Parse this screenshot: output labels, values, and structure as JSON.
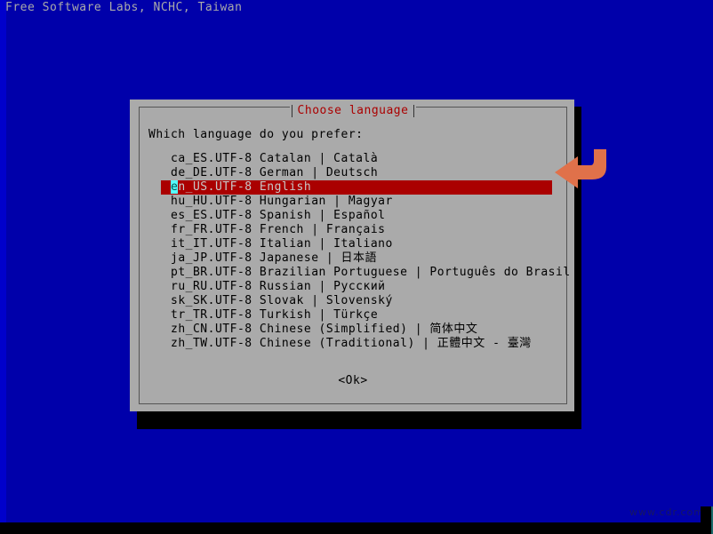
{
  "screen": {
    "header_text": "Free Software Labs, NCHC, Taiwan",
    "background_color": "#0000aa",
    "watermark": "www.cdr.com"
  },
  "dialog": {
    "title": "Choose language",
    "title_color": "#aa0000",
    "prompt": "Which language do you prefer:",
    "background_color": "#aaaaaa",
    "ok_label": "<Ok>",
    "selected_index": 2,
    "highlight_color": "#aa0000",
    "cursor_color": "#55ffff",
    "languages": [
      {
        "locale": "ca_ES.UTF-8",
        "english": "Catalan",
        "native": "| Català"
      },
      {
        "locale": "de_DE.UTF-8",
        "english": "German",
        "native": "| Deutsch"
      },
      {
        "locale": "en_US.UTF-8",
        "english": "English",
        "native": ""
      },
      {
        "locale": "hu_HU.UTF-8",
        "english": "Hungarian",
        "native": "| Magyar"
      },
      {
        "locale": "es_ES.UTF-8",
        "english": "Spanish",
        "native": "| Español"
      },
      {
        "locale": "fr_FR.UTF-8",
        "english": "French",
        "native": "| Français"
      },
      {
        "locale": "it_IT.UTF-8",
        "english": "Italian",
        "native": "| Italiano"
      },
      {
        "locale": "ja_JP.UTF-8",
        "english": "Japanese",
        "native": "| 日本語"
      },
      {
        "locale": "pt_BR.UTF-8",
        "english": "Brazilian Portuguese",
        "native": "| Português do Brasil"
      },
      {
        "locale": "ru_RU.UTF-8",
        "english": "Russian",
        "native": "| Русский"
      },
      {
        "locale": "sk_SK.UTF-8",
        "english": "Slovak",
        "native": "| Slovenský"
      },
      {
        "locale": "tr_TR.UTF-8",
        "english": "Turkish",
        "native": "| Türkçe"
      },
      {
        "locale": "zh_CN.UTF-8",
        "english": "Chinese (Simplified)",
        "native": "| 简体中文"
      },
      {
        "locale": "zh_TW.UTF-8",
        "english": "Chinese (Traditional)",
        "native": "| 正體中文 - 臺灣"
      }
    ]
  },
  "annotation": {
    "arrow_color": "#e0714a",
    "arrow_direction": "left",
    "points_at": "en_US.UTF-8 English"
  }
}
